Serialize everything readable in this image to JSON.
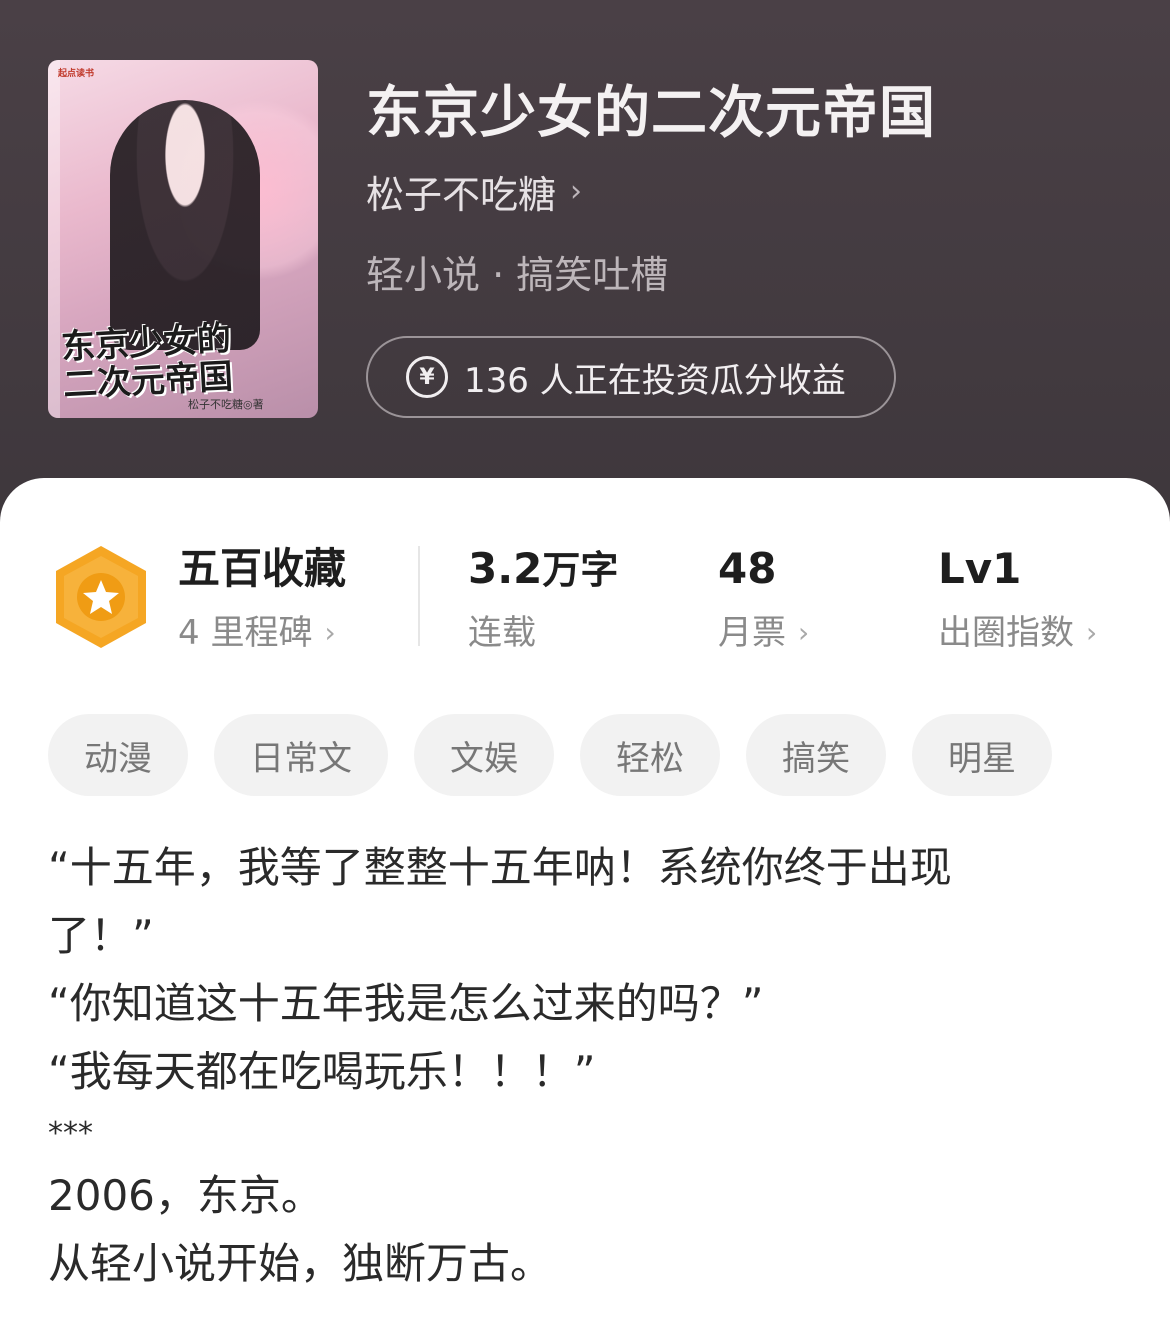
{
  "cover": {
    "publisher": "起点读书",
    "title_line1": "东京少女的",
    "title_line2": "二次元帝国",
    "author_sig": "松子不吃糖◎著"
  },
  "book": {
    "title": "东京少女的二次元帝国",
    "author": "松子不吃糖",
    "genre": "轻小说 · 搞笑吐槽",
    "invest_label": "136 人正在投资瓜分收益"
  },
  "stats": {
    "collect": {
      "value": "五百收藏",
      "sub": "4 里程碑"
    },
    "words": {
      "value": "3.2",
      "unit": "万字",
      "sub": "连载"
    },
    "tickets": {
      "value": "48",
      "sub": "月票"
    },
    "index": {
      "value": "Lv1",
      "sub": "出圈指数"
    }
  },
  "tags": [
    "动漫",
    "日常文",
    "文娱",
    "轻松",
    "搞笑",
    "明星"
  ],
  "synopsis": [
    "“十五年，我等了整整十五年呐！系统你终于出现",
    "了！”",
    "“你知道这十五年我是怎么过来的吗？”",
    "“我每天都在吃喝玩乐！！！”",
    "***",
    "2006，东京。",
    "从轻小说开始，独断万古。"
  ],
  "colors": {
    "badge_orange": "#f5a623",
    "accent_white": "#ffffff"
  }
}
